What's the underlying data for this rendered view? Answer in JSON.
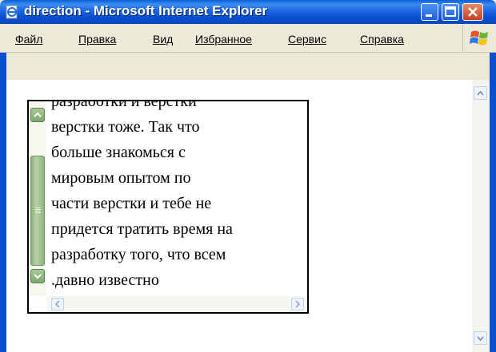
{
  "window": {
    "title": "direction - Microsoft Internet Explorer"
  },
  "menu": [
    {
      "label": "Файл"
    },
    {
      "label": "Правка"
    },
    {
      "label": "Вид"
    },
    {
      "label": "Избранное"
    },
    {
      "label": "Сервис"
    },
    {
      "label": "Справка"
    }
  ],
  "content": {
    "lines": [
      "разработки и верстки",
      "верстки тоже. Так что",
      "больше знакомься с",
      "мировым опытом по",
      "части верстки и тебе не",
      "придется тратить время на",
      "разработку того, что всем",
      ".давно известно"
    ]
  },
  "icons": {
    "app": "ie-page-icon",
    "minimize": "minimize-icon",
    "maximize": "maximize-icon",
    "close": "close-icon",
    "logo": "windows-logo-icon"
  },
  "colors": {
    "titlebar": "#0a4fcf",
    "close": "#c8401c",
    "thumb": "#8ab07a"
  }
}
